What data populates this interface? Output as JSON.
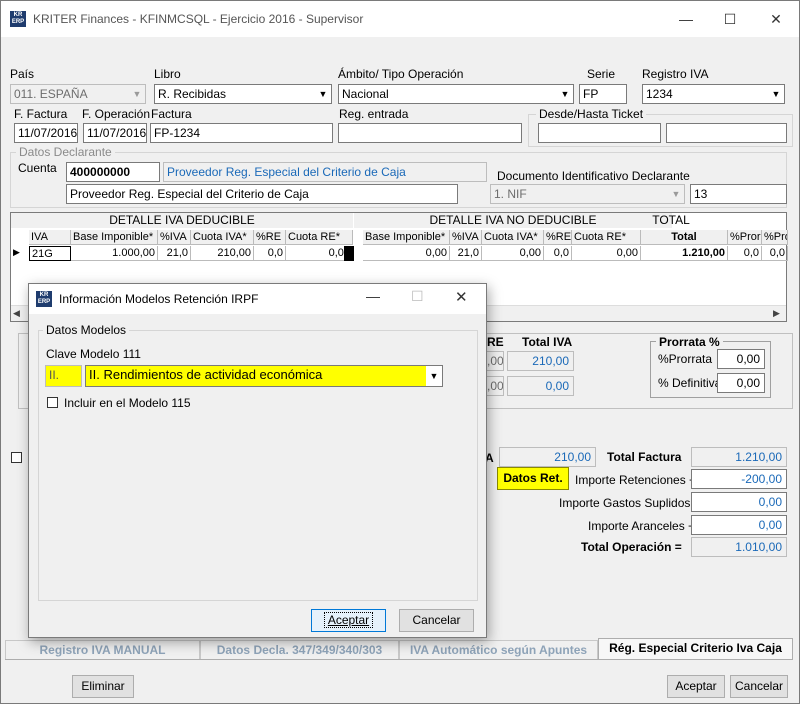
{
  "window": {
    "title": "KRITER Finances - KFINMCSQL - Ejercicio 2016 - Supervisor",
    "icon_text": "KR ERP"
  },
  "header": {
    "pais": {
      "label": "País",
      "value": "011.  ESPAÑA"
    },
    "libro": {
      "label": "Libro",
      "value": "R. Recibidas"
    },
    "ambito": {
      "label": "Ámbito/ Tipo Operación",
      "value": "Nacional"
    },
    "serie": {
      "label": "Serie",
      "value": "FP"
    },
    "registro": {
      "label": "Registro IVA",
      "value": "1234"
    },
    "f_factura": {
      "label": "F. Factura",
      "value": "11/07/2016"
    },
    "f_operacion": {
      "label": "F. Operación",
      "value": "11/07/2016"
    },
    "factura": {
      "label": "Factura",
      "value": "FP-1234"
    },
    "reg_entrada": {
      "label": "Reg. entrada",
      "value": ""
    },
    "ticket": {
      "label": "Desde/Hasta Ticket",
      "from": "",
      "to": ""
    }
  },
  "declarante": {
    "group_title": "Datos Declarante",
    "cuenta_label": "Cuenta",
    "cuenta_value": "400000000",
    "cuenta_name": "Proveedor Reg. Especial del Criterio de Caja",
    "nombre": "Proveedor Reg. Especial del Criterio de Caja",
    "doc_label": "Documento Identificativo Declarante",
    "doc_type": "1. NIF",
    "doc_value": "13"
  },
  "grid": {
    "group_headers": [
      "DETALLE IVA DEDUCIBLE",
      "DETALLE IVA NO DEDUCIBLE",
      "TOTAL"
    ],
    "columns": [
      "IVA",
      "Base Imponible*",
      "%IVA",
      "Cuota IVA*",
      "%RE",
      "Cuota RE*",
      "Base Imponible*",
      "%IVA",
      "Cuota IVA*",
      "%RE",
      "Cuota RE*",
      "Total",
      "%Pror",
      "%Pror"
    ],
    "row": [
      "21G",
      "1.000,00",
      "21,0",
      "210,00",
      "0,0",
      "0,00",
      "0,00",
      "21,0",
      "0,00",
      "0,0",
      "0,00",
      "1.210,00",
      "0,0",
      "0,0"
    ]
  },
  "totals_panel": {
    "re_label": "RE",
    "total_iva_label": "Total IVA",
    "total_iva_1": "210,00",
    "total_iva_2": "0,00",
    "re_val_1": ",00",
    "re_val_2": ",00",
    "prorrata_title": "Prorrata %",
    "prorrata_label": "%Prorrata",
    "prorrata_value": "0,00",
    "definitiva_label": "% Definitiva",
    "definitiva_value": "0,00"
  },
  "summary": {
    "iva_total_suffix": "A",
    "iva_total": "210,00",
    "total_factura_label": "Total Factura",
    "total_factura": "1.210,00",
    "datos_ret_button": "Datos Ret.",
    "retenciones_label": "Importe Retenciones +",
    "retenciones": "-200,00",
    "suplidos_label": "Importe Gastos Suplidos +",
    "suplidos": "0,00",
    "aranceles_label": "Importe Aranceles +",
    "aranceles": "0,00",
    "total_operacion_label": "Total Operación =",
    "total_operacion": "1.010,00"
  },
  "tabs": [
    "Registro IVA MANUAL",
    "Datos Decla. 347/349/340/303",
    "IVA Automático según Apuntes",
    "Rég. Especial Criterio Iva Caja"
  ],
  "footer": {
    "eliminar": "Eliminar",
    "aceptar": "Aceptar",
    "cancelar": "Cancelar"
  },
  "dialog": {
    "title": "Información Modelos Retención IRPF",
    "icon_text": "KR ERP",
    "group_title": "Datos Modelos",
    "clave_label": "Clave Modelo 111",
    "clave_code": "II.",
    "clave_value": "II. Rendimientos de actividad económica",
    "checkbox_label": "Incluir en el Modelo 115",
    "aceptar": "Aceptar",
    "cancelar": "Cancelar"
  },
  "colors": {
    "highlight": "#ffff00",
    "link_blue": "#1a69b8",
    "focus": "#0078d7"
  }
}
